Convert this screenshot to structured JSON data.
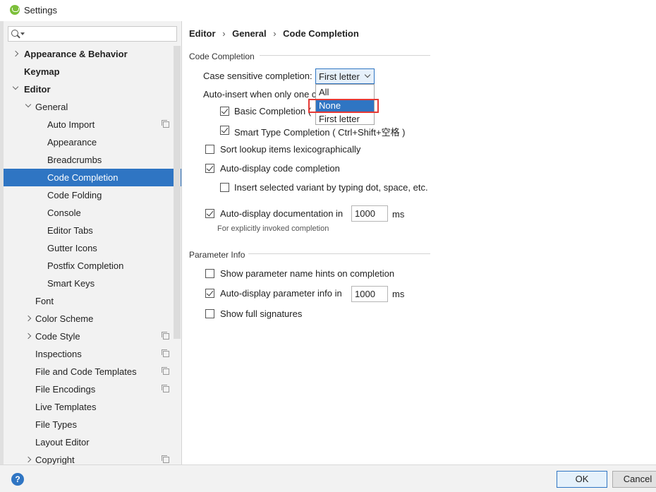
{
  "window": {
    "title": "Settings"
  },
  "search": {
    "placeholder": ""
  },
  "tree": [
    {
      "label": "Appearance & Behavior",
      "indent": 0,
      "bold": true,
      "arrow": "right",
      "copy": false
    },
    {
      "label": "Keymap",
      "indent": 0,
      "bold": true,
      "arrow": "",
      "copy": false
    },
    {
      "label": "Editor",
      "indent": 0,
      "bold": true,
      "arrow": "down",
      "copy": false
    },
    {
      "label": "General",
      "indent": 1,
      "bold": false,
      "arrow": "down",
      "copy": false
    },
    {
      "label": "Auto Import",
      "indent": 2,
      "bold": false,
      "arrow": "",
      "copy": true
    },
    {
      "label": "Appearance",
      "indent": 2,
      "bold": false,
      "arrow": "",
      "copy": false
    },
    {
      "label": "Breadcrumbs",
      "indent": 2,
      "bold": false,
      "arrow": "",
      "copy": false
    },
    {
      "label": "Code Completion",
      "indent": 2,
      "bold": false,
      "arrow": "",
      "copy": false,
      "selected": true
    },
    {
      "label": "Code Folding",
      "indent": 2,
      "bold": false,
      "arrow": "",
      "copy": false
    },
    {
      "label": "Console",
      "indent": 2,
      "bold": false,
      "arrow": "",
      "copy": false
    },
    {
      "label": "Editor Tabs",
      "indent": 2,
      "bold": false,
      "arrow": "",
      "copy": false
    },
    {
      "label": "Gutter Icons",
      "indent": 2,
      "bold": false,
      "arrow": "",
      "copy": false
    },
    {
      "label": "Postfix Completion",
      "indent": 2,
      "bold": false,
      "arrow": "",
      "copy": false
    },
    {
      "label": "Smart Keys",
      "indent": 2,
      "bold": false,
      "arrow": "",
      "copy": false
    },
    {
      "label": "Font",
      "indent": 1,
      "bold": false,
      "arrow": "",
      "copy": false
    },
    {
      "label": "Color Scheme",
      "indent": 1,
      "bold": false,
      "arrow": "right",
      "copy": false
    },
    {
      "label": "Code Style",
      "indent": 1,
      "bold": false,
      "arrow": "right",
      "copy": true
    },
    {
      "label": "Inspections",
      "indent": 1,
      "bold": false,
      "arrow": "",
      "copy": true
    },
    {
      "label": "File and Code Templates",
      "indent": 1,
      "bold": false,
      "arrow": "",
      "copy": true
    },
    {
      "label": "File Encodings",
      "indent": 1,
      "bold": false,
      "arrow": "",
      "copy": true
    },
    {
      "label": "Live Templates",
      "indent": 1,
      "bold": false,
      "arrow": "",
      "copy": false
    },
    {
      "label": "File Types",
      "indent": 1,
      "bold": false,
      "arrow": "",
      "copy": false
    },
    {
      "label": "Layout Editor",
      "indent": 1,
      "bold": false,
      "arrow": "",
      "copy": false
    },
    {
      "label": "Copyright",
      "indent": 1,
      "bold": false,
      "arrow": "right",
      "copy": true
    }
  ],
  "breadcrumb": {
    "items": [
      "Editor",
      "General",
      "Code Completion"
    ],
    "separator": "›"
  },
  "code_completion": {
    "section_title": "Code Completion",
    "case_sensitive_label": "Case sensitive completion:",
    "case_sensitive_value": "First letter",
    "dropdown_options": [
      "All",
      "None",
      "First letter"
    ],
    "dropdown_highlighted": "None",
    "auto_insert_label": "Auto-insert when only one c",
    "basic_completion_label": "Basic Completion (",
    "basic_completion_checked": true,
    "smart_type_label": "Smart Type Completion ( Ctrl+Shift+空格 )",
    "smart_type_checked": true,
    "sort_lookup_label": "Sort lookup items lexicographically",
    "sort_lookup_checked": false,
    "auto_display_code_label": "Auto-display code completion",
    "auto_display_code_checked": true,
    "insert_variant_label": "Insert selected variant by typing dot, space, etc.",
    "insert_variant_checked": false,
    "auto_display_doc_label": "Auto-display documentation in",
    "auto_display_doc_checked": true,
    "auto_display_doc_value": "1000",
    "auto_display_doc_unit": "ms",
    "doc_hint": "For explicitly invoked completion"
  },
  "parameter_info": {
    "section_title": "Parameter Info",
    "show_hints_label": "Show parameter name hints on completion",
    "show_hints_checked": false,
    "auto_display_param_label": "Auto-display parameter info in",
    "auto_display_param_checked": true,
    "auto_display_param_value": "1000",
    "auto_display_param_unit": "ms",
    "show_full_label": "Show full signatures",
    "show_full_checked": false
  },
  "buttons": {
    "help": "?",
    "ok": "OK",
    "cancel": "Cancel"
  },
  "colors": {
    "selection": "#2f75c3",
    "highlight_box": "#e53935",
    "sidebar_bg": "#f2f2f2"
  }
}
